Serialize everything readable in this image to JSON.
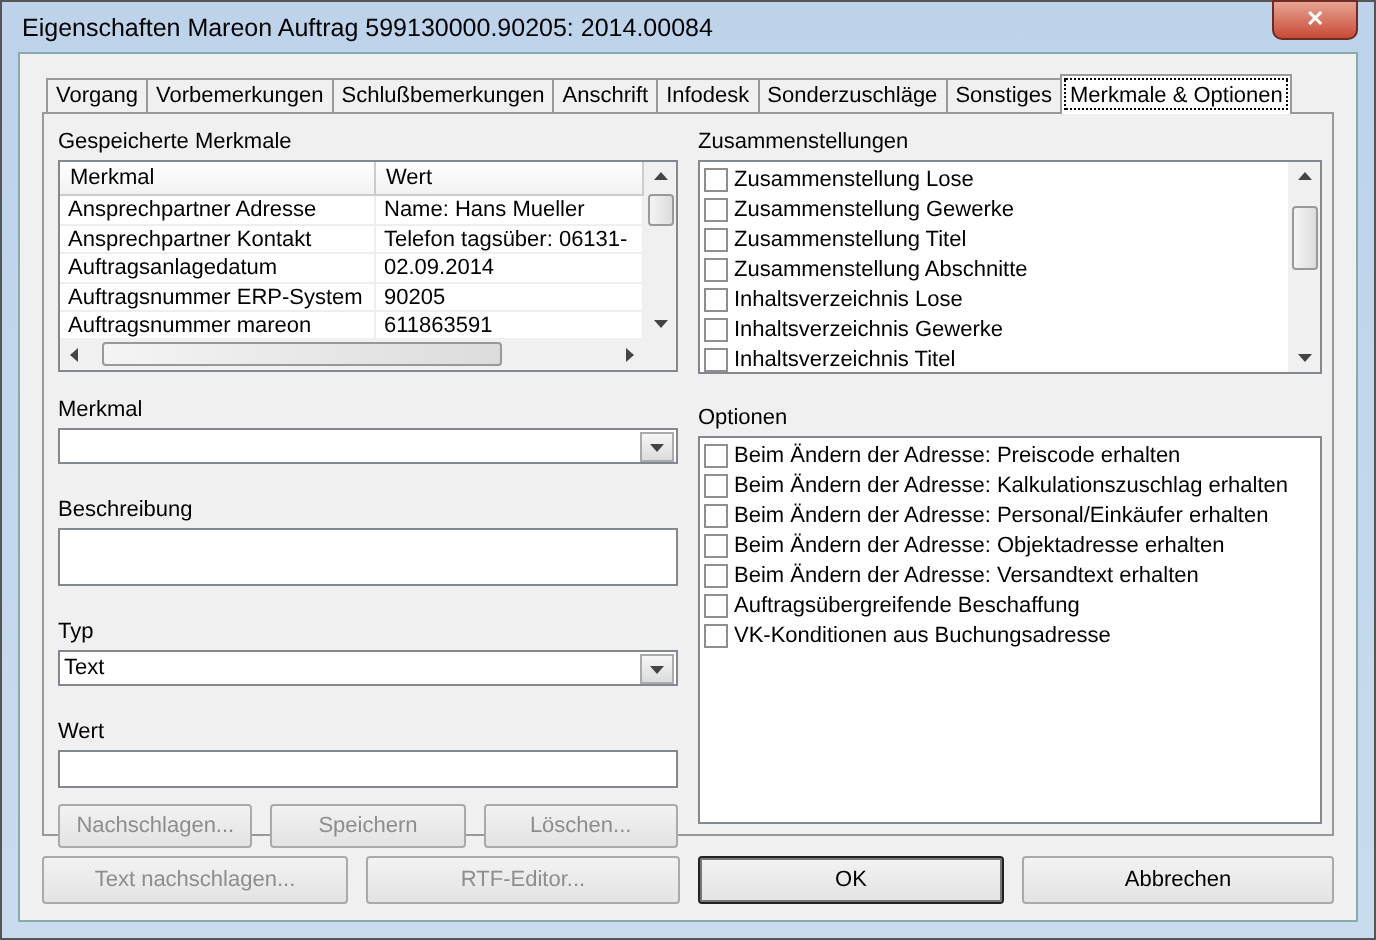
{
  "window": {
    "title": "Eigenschaften Mareon Auftrag 599130000.90205: 2014.00084",
    "close": "✕"
  },
  "tabs": [
    {
      "label": "Vorgang",
      "selected": false
    },
    {
      "label": "Vorbemerkungen",
      "selected": false
    },
    {
      "label": "Schlußbemerkungen",
      "selected": false
    },
    {
      "label": "Anschrift",
      "selected": false
    },
    {
      "label": "Infodesk",
      "selected": false
    },
    {
      "label": "Sonderzuschläge",
      "selected": false
    },
    {
      "label": "Sonstiges",
      "selected": false
    },
    {
      "label": "Merkmale & Optionen",
      "selected": true
    }
  ],
  "saved": {
    "label": "Gespeicherte Merkmale",
    "columns": [
      "Merkmal",
      "Wert"
    ],
    "rows": [
      [
        "Ansprechpartner Adresse",
        "Name: Hans Mueller"
      ],
      [
        "Ansprechpartner Kontakt",
        "Telefon tagsüber: 06131-"
      ],
      [
        "Auftragsanlagedatum",
        "02.09.2014"
      ],
      [
        "Auftragsnummer ERP-System",
        "90205"
      ],
      [
        "Auftragsnummer mareon",
        "611863591"
      ]
    ]
  },
  "fields": [
    {
      "kind": "combo",
      "label": "Merkmal"
    },
    {
      "kind": "textarea",
      "label": "Beschreibung"
    },
    {
      "kind": "combo",
      "label": "Typ",
      "value": "Text"
    },
    {
      "kind": "input",
      "label": "Wert"
    }
  ],
  "form_buttons": [
    {
      "label": "Nachschlagen...",
      "disabled": true
    },
    {
      "label": "Speichern",
      "disabled": true
    },
    {
      "label": "Löschen...",
      "disabled": true
    }
  ],
  "compilations": {
    "label": "Zusammenstellungen",
    "items": [
      {
        "label": "Zusammenstellung Lose",
        "checked": false
      },
      {
        "label": "Zusammenstellung Gewerke",
        "checked": false
      },
      {
        "label": "Zusammenstellung Titel",
        "checked": false
      },
      {
        "label": "Zusammenstellung Abschnitte",
        "checked": false
      },
      {
        "label": "Inhaltsverzeichnis Lose",
        "checked": false
      },
      {
        "label": "Inhaltsverzeichnis Gewerke",
        "checked": false
      },
      {
        "label": "Inhaltsverzeichnis Titel",
        "checked": false
      }
    ]
  },
  "options": {
    "label": "Optionen",
    "items": [
      {
        "label": "Beim Ändern der Adresse: Preiscode erhalten",
        "checked": false
      },
      {
        "label": "Beim Ändern der Adresse: Kalkulationszuschlag erhalten",
        "checked": false
      },
      {
        "label": "Beim Ändern der Adresse: Personal/Einkäufer erhalten",
        "checked": false
      },
      {
        "label": "Beim Ändern der Adresse: Objektadresse erhalten",
        "checked": false
      },
      {
        "label": "Beim Ändern der Adresse: Versandtext erhalten",
        "checked": false
      },
      {
        "label": "Auftragsübergreifende Beschaffung",
        "checked": false
      },
      {
        "label": "VK-Konditionen aus Buchungsadresse",
        "checked": false
      }
    ]
  },
  "buttons": [
    {
      "label": "Text nachschlagen...",
      "disabled": true,
      "default": false
    },
    {
      "label": "RTF-Editor...",
      "disabled": true,
      "default": false
    },
    {
      "label": "OK",
      "disabled": false,
      "default": true
    },
    {
      "label": "Abbrechen",
      "disabled": false,
      "default": false
    }
  ]
}
